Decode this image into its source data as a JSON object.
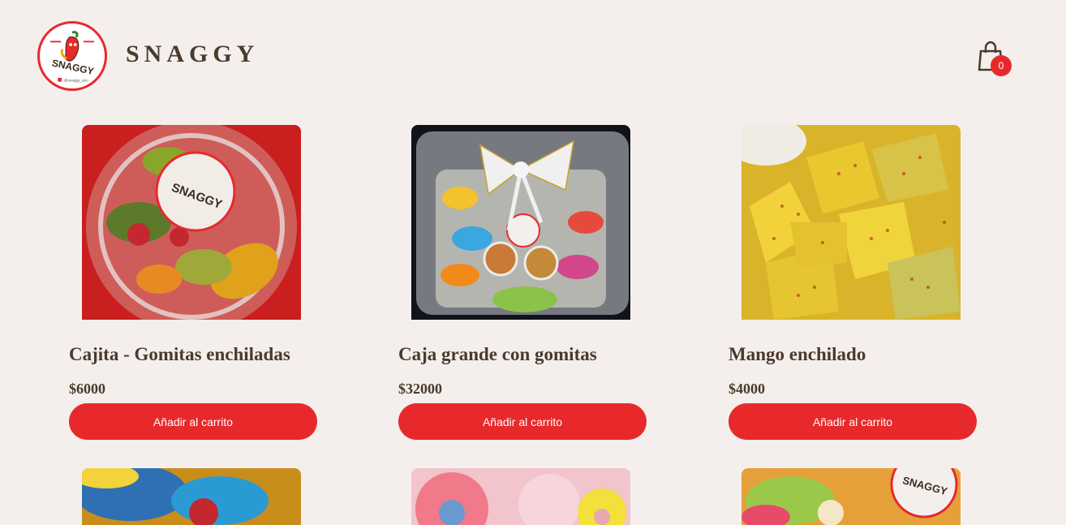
{
  "brand": {
    "name": "SNAGGY",
    "logo_text": "SNAGGY",
    "logo_handle": "@snaggy_ano"
  },
  "cart": {
    "count": "0",
    "icon": "shopping-bag-icon"
  },
  "colors": {
    "accent": "#e8292c",
    "text": "#4a3a2c",
    "background": "#f4efed"
  },
  "products": [
    {
      "title": "Cajita - Gomitas enchiladas",
      "price": "$6000",
      "button": "Añadir al carrito",
      "image": "gummies-cup-image"
    },
    {
      "title": "Caja grande con gomitas",
      "price": "$32000",
      "button": "Añadir al carrito",
      "image": "gummies-box-image"
    },
    {
      "title": "Mango enchilado",
      "price": "$4000",
      "button": "Añadir al carrito",
      "image": "mango-image"
    }
  ],
  "more_products": [
    "sour-candy-image",
    "gummy-rings-image",
    "candy-bag-image"
  ]
}
